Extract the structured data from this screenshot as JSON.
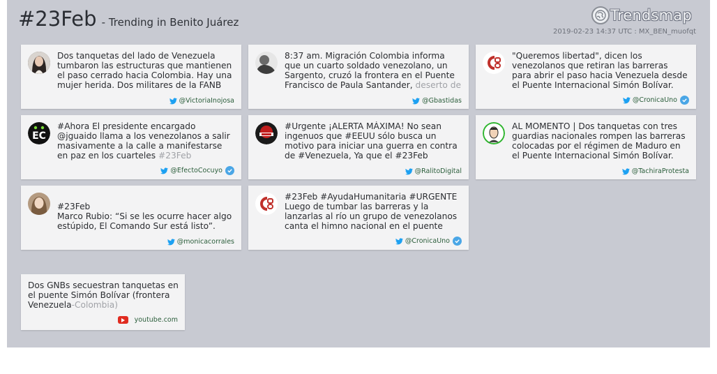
{
  "header": {
    "hashtag": "#23Feb",
    "subtitle": "- Trending in Benito Juárez",
    "brand": "Trendsmap",
    "timestamp": "2019-02-23 14:37 UTC : MX_BEN_muofqt"
  },
  "tweets": [
    {
      "text_main": "Dos tanquetas del lado de Venezuela tumbaron las estructuras que mantienen el paso cerrado hacia Colombia. Hay una mujer herida. Dos militares de la FANB",
      "text_fade": "",
      "user": "@VictoriaInojosa",
      "verified": false,
      "avatar_icon": "woman-portrait-avatar",
      "avatar_bg": "#3a3a3a"
    },
    {
      "text_main": "8:37 am. Migración Colombia informa que un cuarto soldado venezolano, un Sargento, cruzó la frontera en el Puente Francisco de Paula Santander,",
      "text_fade": " deserto de",
      "user": "@Gbastidas",
      "verified": false,
      "avatar_icon": "man-portrait-avatar",
      "avatar_bg": "#8a8a8a"
    },
    {
      "text_main": "\"Queremos libertad\", dicen los venezolanos que retiran las barreras para abrir el paso hacia Venezuela desde el Puente Internacional Simón Bolívar. Vía",
      "text_fade": "",
      "user": "@CronicaUno",
      "verified": true,
      "avatar_icon": "cronica-uno-logo-avatar",
      "avatar_bg": "#ffffff"
    },
    {
      "text_main": "#Ahora El presidente encargado @jguaido llama a los venezolanos a salir masivamente a la calle a manifestarse en paz en los cuarteles",
      "text_fade": " #23Feb",
      "user": "@EfectoCocuyo",
      "verified": true,
      "avatar_icon": "efecto-cocuyo-logo-avatar",
      "avatar_bg": "#111111"
    },
    {
      "text_main": "#Urgente ¡ALERTA MÁXIMA! No sean ingenuos que #EEUU sólo busca un motivo para iniciar una guerra en contra de #Venezuela, Ya que el #23Feb",
      "text_fade": "",
      "user": "@RalitoDigital",
      "verified": false,
      "avatar_icon": "ralito-digital-logo-avatar",
      "avatar_bg": "#1a1a1a"
    },
    {
      "text_main": "AL MOMENTO | Dos tanquetas con tres guardias nacionales rompen las barreras colocadas por el régimen de Maduro en el Puente Internacional Simón Bolívar. Los",
      "text_fade": "",
      "user": "@TachiraProtesta",
      "verified": false,
      "avatar_icon": "tachira-protesta-avatar",
      "avatar_bg": "#ffffff"
    },
    {
      "text_main": "#23Feb\nMarco Rubio: “Si se les ocurre hacer algo estúpido, El Comando Sur está listo”.",
      "text_fade": "",
      "user": "@monicacorrales",
      "verified": false,
      "avatar_icon": "woman-portrait-avatar",
      "avatar_bg": "#b49a80"
    },
    {
      "text_main": "#23Feb #AyudaHumanitaria #URGENTE Luego de tumbar las barreras y la lanzarlas al río un grupo de venezolanos canta el himno nacional en el puente",
      "text_fade": "",
      "user": "@CronicaUno",
      "verified": true,
      "avatar_icon": "cronica-uno-logo-avatar",
      "avatar_bg": "#ffffff"
    }
  ],
  "video": {
    "text_main": "Dos GNBs secuestran tanquetas en el puente Simón Bolívar (frontera Venezuela",
    "text_fade": "-Colombia)",
    "source": "youtube.com"
  },
  "colors": {
    "panel_bg": "#c8cad2",
    "card_bg": "#f3f3f4",
    "username": "#2a5d3a",
    "twitter_blue": "#1da1f2",
    "verified_blue": "#4aa6e6",
    "youtube_red": "#e02b20"
  }
}
